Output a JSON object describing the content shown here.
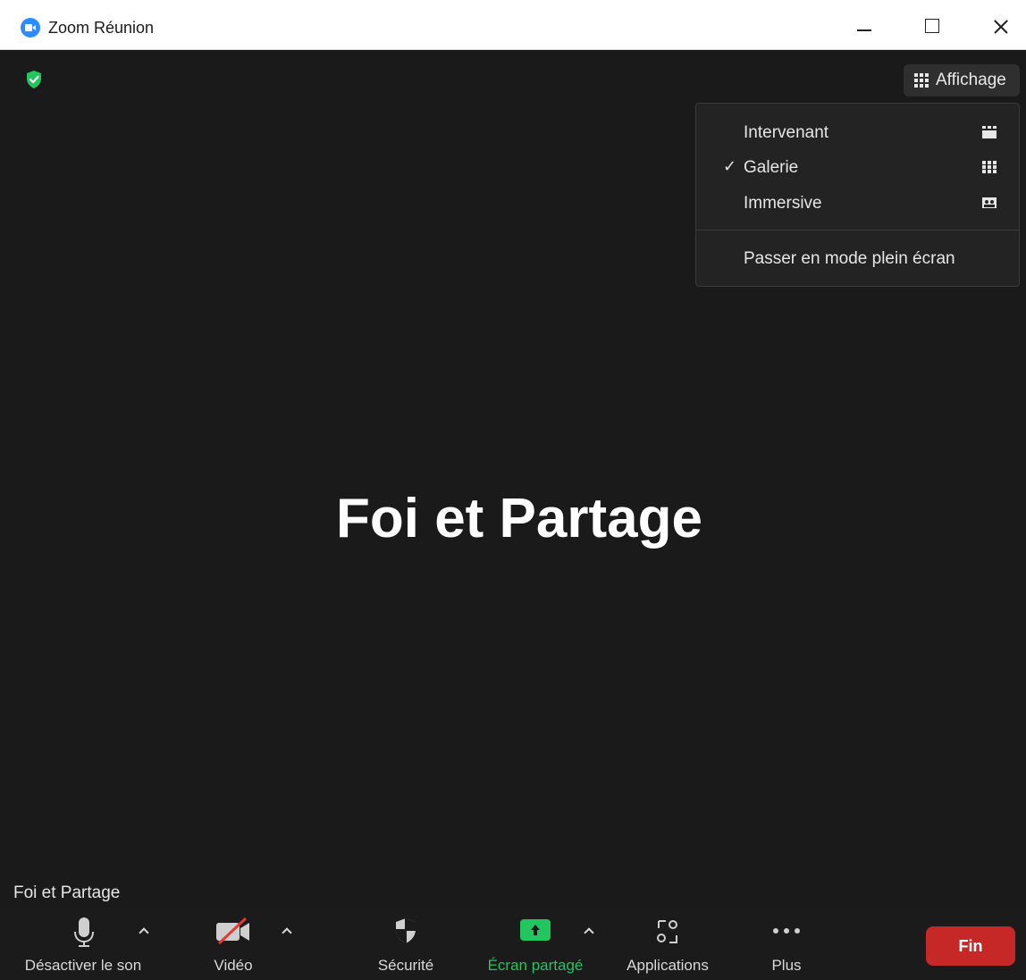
{
  "window": {
    "title": "Zoom Réunion"
  },
  "view_button": {
    "label": "Affichage"
  },
  "view_menu": {
    "items": [
      {
        "label": "Intervenant",
        "checked": false,
        "icon": "speaker-view-icon"
      },
      {
        "label": "Galerie",
        "checked": true,
        "icon": "gallery-view-icon"
      },
      {
        "label": "Immersive",
        "checked": false,
        "icon": "immersive-view-icon"
      }
    ],
    "fullscreen_label": "Passer en mode plein écran",
    "check_mark": "✓"
  },
  "main": {
    "participant_display_name": "Foi et Partage",
    "name_tag": "Foi et Partage"
  },
  "toolbar": {
    "mute_label": "Désactiver le son",
    "video_label": "Vidéo",
    "security_label": "Sécurité",
    "share_label": "Écran partagé",
    "apps_label": "Applications",
    "more_label": "Plus",
    "end_label": "Fin"
  },
  "colors": {
    "background": "#1a1a1a",
    "accent_green": "#22c55e",
    "end_red": "#c62828",
    "zoom_blue": "#2d8cff"
  }
}
